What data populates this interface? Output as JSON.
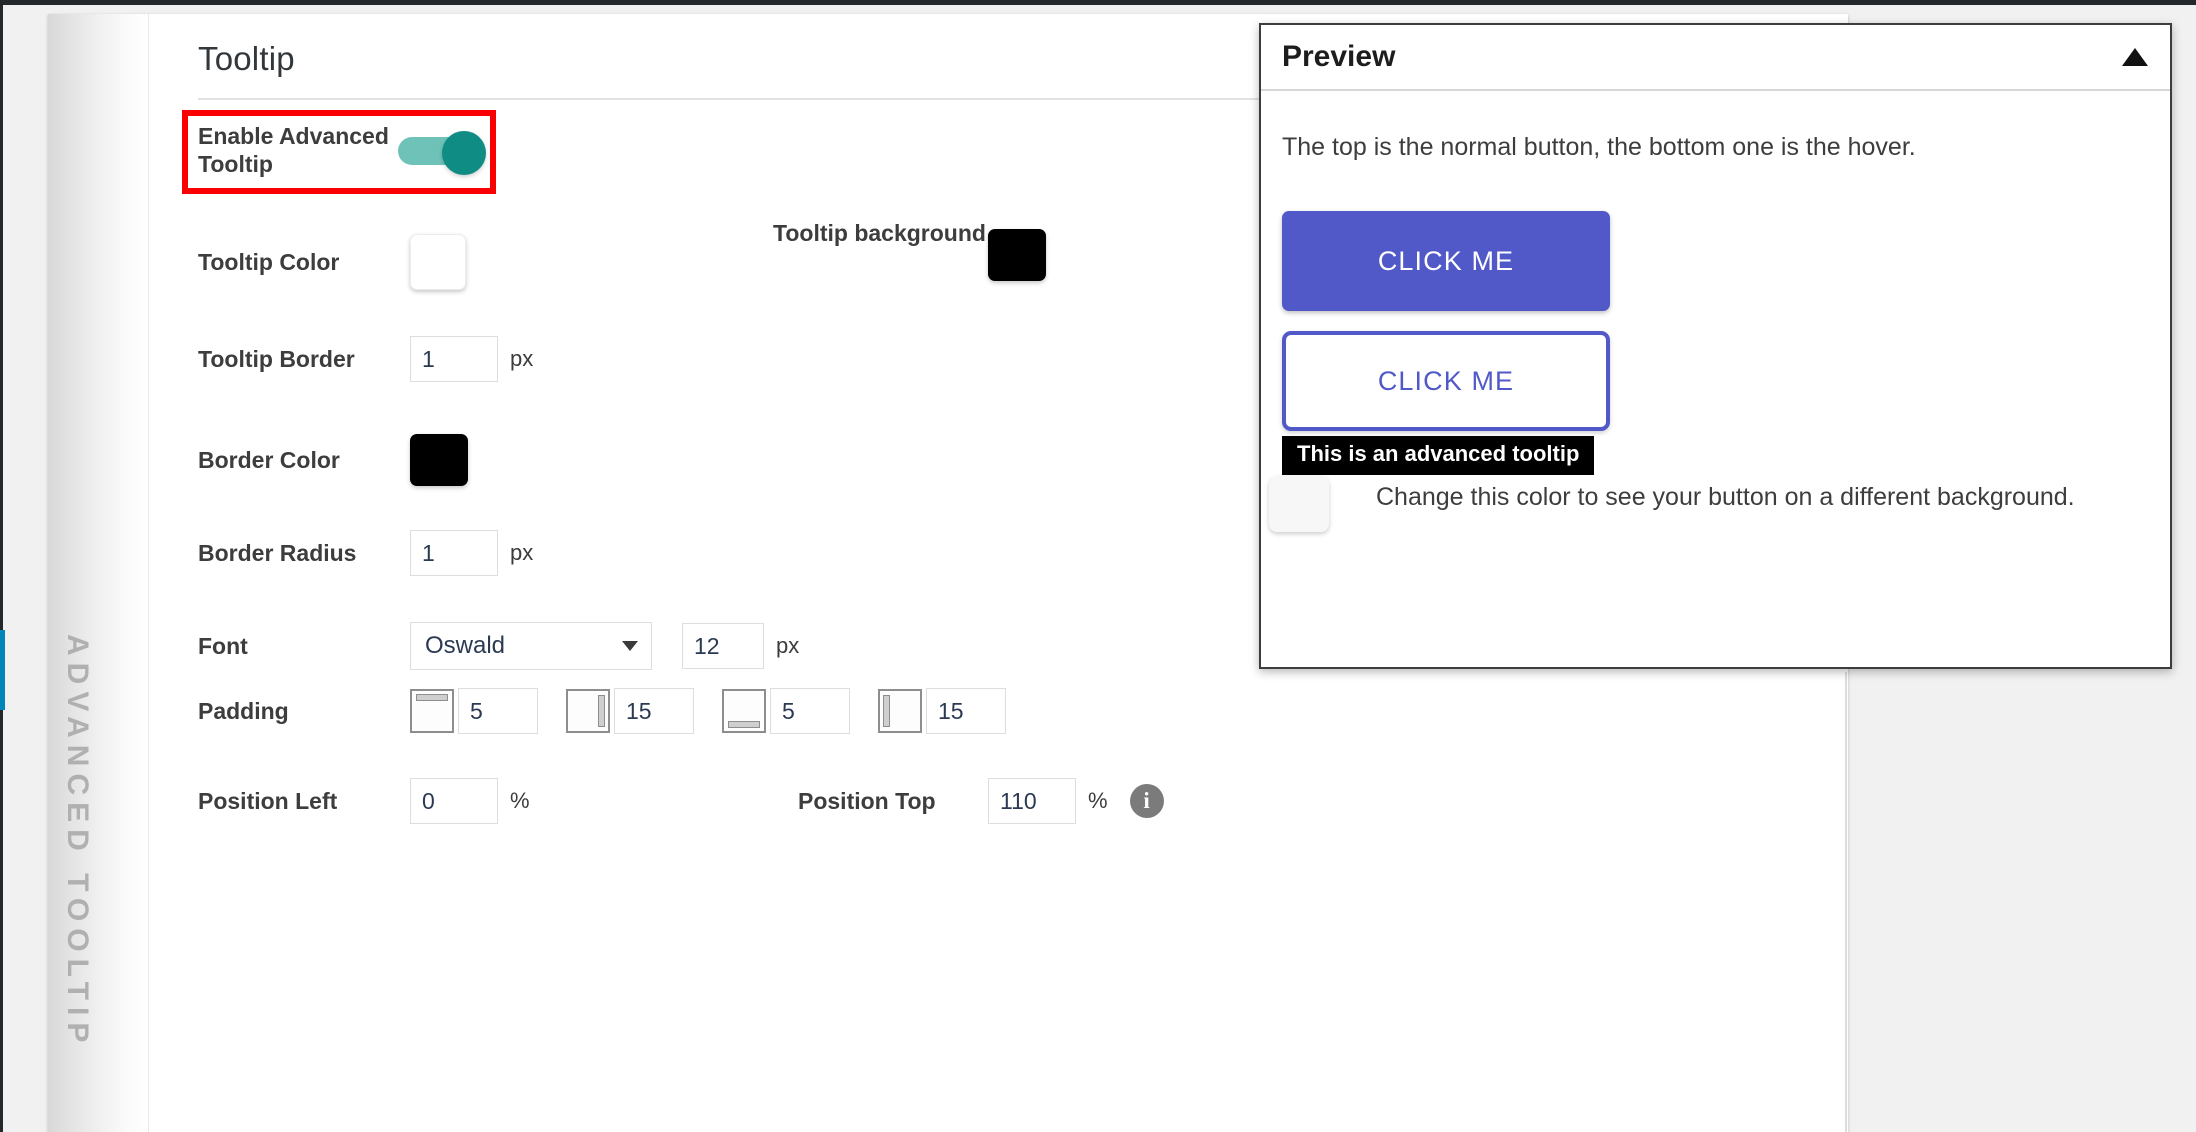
{
  "sidebar": {
    "vertical_label": "ADVANCED TOOLTIP"
  },
  "section": {
    "title": "Tooltip"
  },
  "toggle_row": {
    "label": "Enable Advanced Tooltip",
    "state": "on",
    "track_color": "#6fc2b7",
    "knob_color": "#0f8d84",
    "highlight_color": "#fb0000"
  },
  "fields": {
    "tooltip_color": {
      "label": "Tooltip Color",
      "value": "#ffffff"
    },
    "tooltip_background": {
      "label": "Tooltip background",
      "value": "#000000"
    },
    "tooltip_border": {
      "label": "Tooltip Border",
      "value": "1",
      "unit": "px"
    },
    "border_color": {
      "label": "Border Color",
      "value": "#000000"
    },
    "border_radius": {
      "label": "Border Radius",
      "value": "1",
      "unit": "px"
    },
    "font": {
      "label": "Font",
      "family_value": "Oswald",
      "size_value": "12",
      "unit": "px",
      "caret": "chevron-down-icon"
    },
    "padding": {
      "label": "Padding",
      "items": [
        {
          "icon": "padding-top-icon",
          "value": "5"
        },
        {
          "icon": "padding-right-icon",
          "value": "15"
        },
        {
          "icon": "padding-bottom-icon",
          "value": "5"
        },
        {
          "icon": "padding-left-icon",
          "value": "15"
        }
      ]
    },
    "position_left": {
      "label": "Position Left",
      "value": "0",
      "unit": "%"
    },
    "position_top": {
      "label": "Position Top",
      "value": "110",
      "unit": "%",
      "info": "info-icon"
    }
  },
  "preview": {
    "title": "Preview",
    "collapse_icon": "triangle-up-icon",
    "note": "The top is the normal button, the bottom one is the hover.",
    "normal_button": {
      "label": "CLICK ME",
      "bg": "#5159c9",
      "text": "#ffffff"
    },
    "hover_button": {
      "label": "CLICK ME",
      "bg": "#ffffff",
      "text": "#5159c9",
      "border": "#5159c9"
    },
    "tooltip_text": "This is an advanced tooltip",
    "background_swatch_value": "#f7f7f7",
    "background_note": "Change this color to see your button on a different background."
  }
}
